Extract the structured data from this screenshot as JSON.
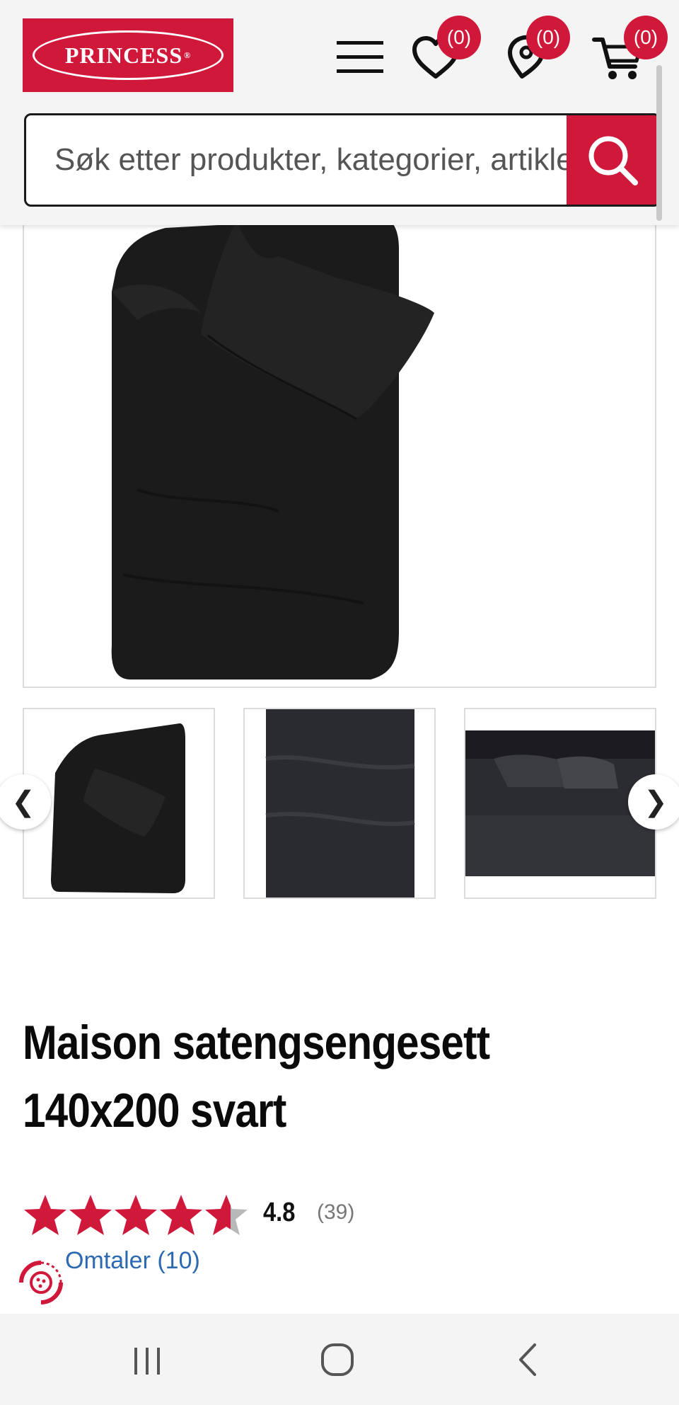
{
  "header": {
    "logo_text": "PRINCESS",
    "logo_reg": "®",
    "wishlist_count": "(0)",
    "stores_count": "(0)",
    "cart_count": "(0)",
    "brand_color": "#d0193a"
  },
  "search": {
    "placeholder": "Søk etter produkter, kategorier, artikler"
  },
  "gallery": {
    "main_image": "black-satin-duvet-cover-with-pillowcase",
    "thumbnails": [
      "black-duvet-set-flat",
      "black-duvet-closeup",
      "black-bedroom-scene"
    ],
    "prev_label": "❮",
    "next_label": "❯"
  },
  "product": {
    "title_line1": "Maison satengsengesett",
    "title_line2": "140x200 svart",
    "rating": "4.8",
    "rating_count": "(39)",
    "rating_fraction": 0.96,
    "reviews_link": "Omtaler (10)"
  },
  "icons": [
    "menu-icon",
    "heart-icon",
    "location-icon",
    "cart-icon",
    "search-icon",
    "star-icon",
    "cookie-settings-icon",
    "recent-apps-icon",
    "home-icon",
    "back-icon"
  ]
}
